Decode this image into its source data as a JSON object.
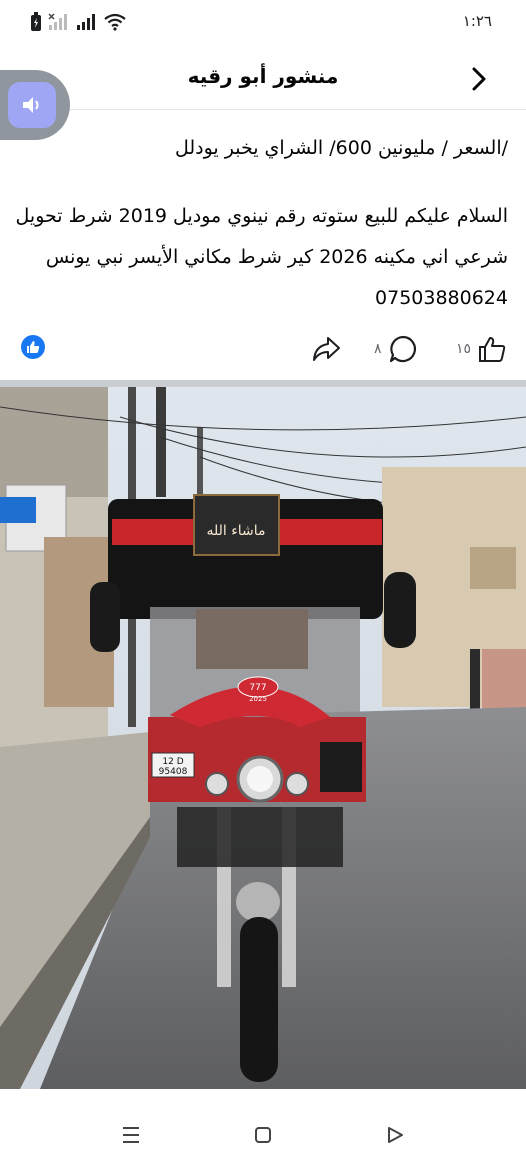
{
  "status_bar": {
    "time": "١:٢٦",
    "icons": [
      "battery-icon",
      "signal-empty-icon",
      "signal-icon",
      "wifi-icon"
    ]
  },
  "header": {
    "title": "منشور أبو رقيه",
    "back_icon": "chevron-right-icon"
  },
  "floating_bubble": {
    "icon": "speaker-icon"
  },
  "post": {
    "line1": "/السعر / مليونين 600/ الشراي يخبر يودلل",
    "body": "السلام عليكم للبيع ستوته رقم نينوي موديل 2019 شرط تحويل شرعي اني مكينه 2026 كير شرط مكاني الأيسر نبي يونس 07503880624"
  },
  "actions": {
    "like_count": "١٥",
    "comment_count": "٨",
    "like_icon": "thumbs-up-icon",
    "comment_icon": "comment-icon",
    "share_icon": "share-icon",
    "reaction_icon": "facebook-like-icon",
    "accent_color": "#1877f2"
  },
  "photo": {
    "banner_text": "ماشاء الله",
    "plate_number": "12 D",
    "plate_serial": "95408",
    "badge_text": "777",
    "badge_year": "2025"
  },
  "nav_bar": {
    "icons": [
      "recent-apps-icon",
      "home-icon",
      "back-triangle-icon"
    ]
  }
}
